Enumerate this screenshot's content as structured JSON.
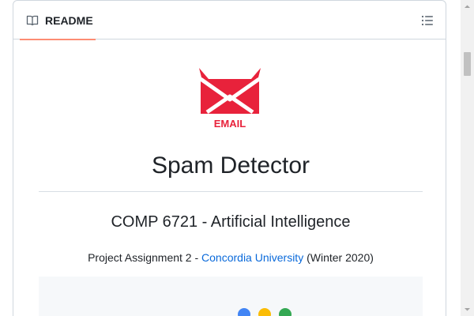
{
  "readme_tab": {
    "label": "README",
    "icon": "book-icon"
  },
  "header_actions": {
    "outline_icon": "list-unordered-icon"
  },
  "logo": {
    "alt": "EMAIL",
    "text": "EMAIL",
    "primary_color": "#e8223b"
  },
  "content": {
    "title": "Spam Detector",
    "course": "COMP 6721 - Artificial Intelligence",
    "assignment_prefix": "Project Assignment 2 - ",
    "university_link": "Concordia University",
    "assignment_suffix": " (Winter 2020)"
  },
  "demo": {
    "dot_colors": [
      "#4285f4",
      "#fbbc05",
      "#34a853"
    ]
  },
  "colors": {
    "accent_underline": "#fd8c73",
    "link": "#0969da"
  }
}
